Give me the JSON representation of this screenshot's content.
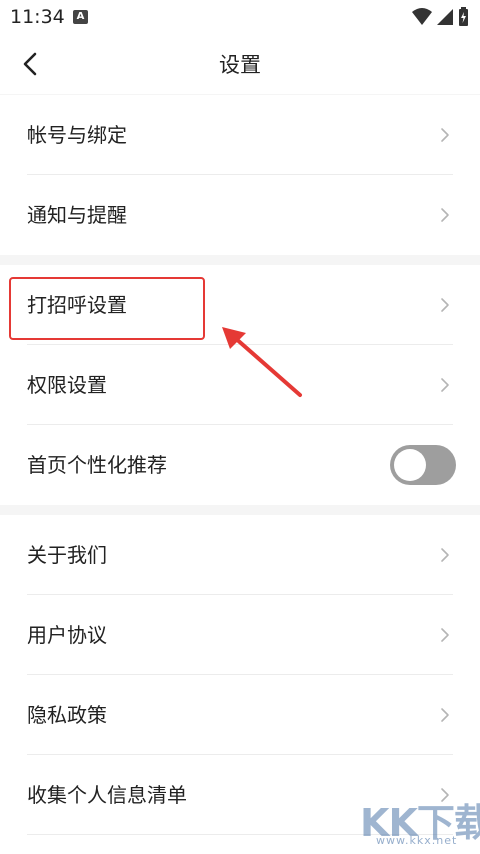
{
  "status_bar": {
    "time": "11:34",
    "notification_icon": "a-letter-icon",
    "icons": [
      "wifi-icon",
      "cellular-signal-icon",
      "battery-charging-icon"
    ]
  },
  "header": {
    "title": "设置",
    "back_icon": "chevron-left-icon"
  },
  "groups": [
    {
      "items": [
        {
          "label": "帐号与绑定",
          "control": "chevron"
        },
        {
          "label": "通知与提醒",
          "control": "chevron"
        }
      ]
    },
    {
      "items": [
        {
          "label": "打招呼设置",
          "control": "chevron"
        },
        {
          "label": "权限设置",
          "control": "chevron"
        },
        {
          "label": "首页个性化推荐",
          "control": "toggle",
          "toggle_on": false
        }
      ]
    },
    {
      "items": [
        {
          "label": "关于我们",
          "control": "chevron"
        },
        {
          "label": "用户协议",
          "control": "chevron"
        },
        {
          "label": "隐私政策",
          "control": "chevron"
        },
        {
          "label": "收集个人信息清单",
          "control": "chevron"
        }
      ]
    }
  ],
  "annotation": {
    "highlight_color": "#e53935",
    "target": "打招呼设置"
  },
  "watermark": {
    "logo_text": "KK下载",
    "url": "www.kkx.net"
  },
  "colors": {
    "background": "#f5f5f5",
    "card": "#ffffff",
    "text": "#222222",
    "chevron": "#b5b5b5",
    "toggle_off": "#9e9e9e"
  }
}
